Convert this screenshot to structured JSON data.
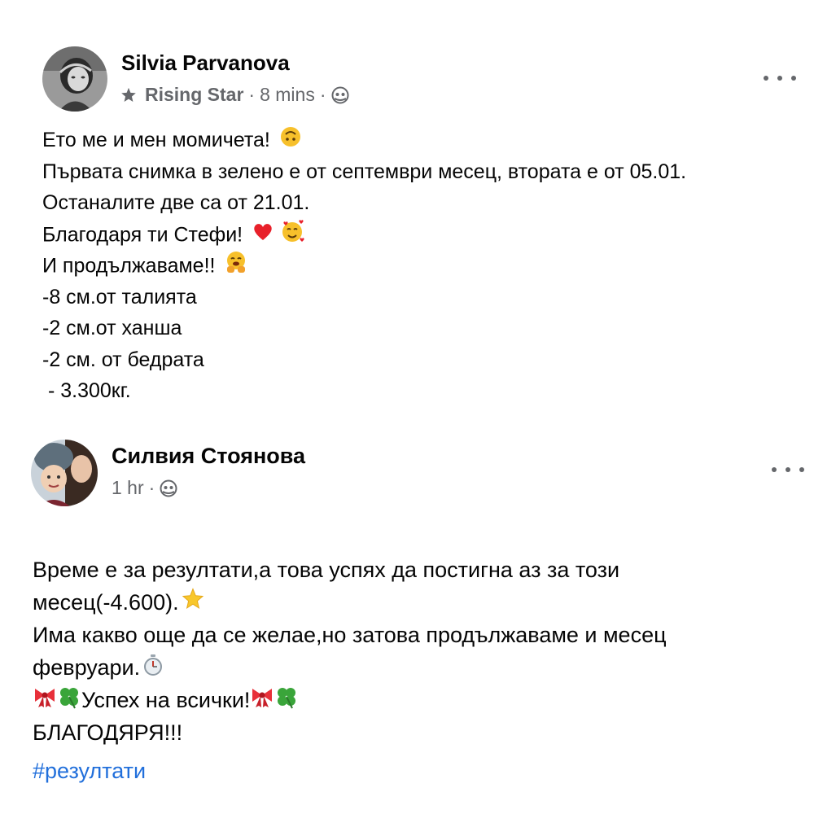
{
  "post1": {
    "author": "Silvia Parvanova",
    "badge_icon": "star-badge-icon",
    "badge": "Rising Star",
    "separator": "·",
    "time": "8 mins",
    "separator2": "·",
    "audience_icon": "public-globe-icon",
    "more_icon": "more-options-icon",
    "lines": [
      "Ето ме и мен момичета!",
      "Първата снимка в зелено е от септември месец, втората е от 05.01.",
      "Останалите две са от 21.01.",
      "Благодаря ти Стефи!",
      "И продължаваме!!",
      "-8 см.от талията",
      "-2 см.от ханша",
      "-2 см. от бедрата",
      " - 3.300кг."
    ]
  },
  "post2": {
    "author": "Силвия Стоянова",
    "time": "1 hr",
    "separator": "·",
    "audience_icon": "public-globe-icon",
    "more_icon": "more-options-icon",
    "lines": [
      "Време е за резултати,а това успях да постигна аз за този",
      "месец(-4.600).",
      "Има какво още да се желае,но затова продължаваме и месец",
      "февруари.",
      "Успех на всички!",
      "БЛАГОДЯРЯ!!!"
    ],
    "hashtag": "#резултати"
  },
  "colors": {
    "text": "#050505",
    "secondary": "#65676b",
    "link": "#216fdb"
  }
}
